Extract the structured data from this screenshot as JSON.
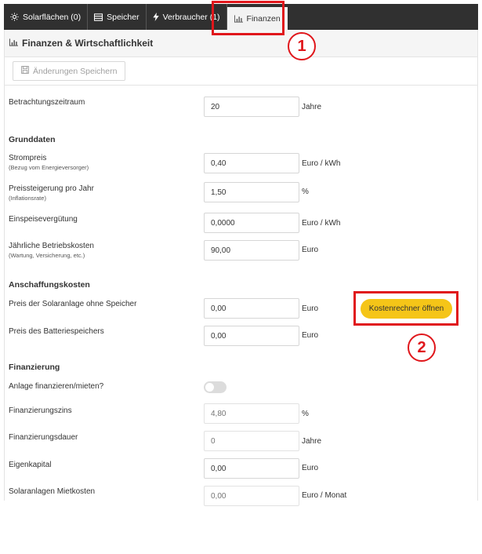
{
  "tabs": [
    {
      "label": "Solarflächen (0)",
      "icon": "sun-icon"
    },
    {
      "label": "Speicher",
      "icon": "battery-icon"
    },
    {
      "label": "Verbraucher (1)",
      "icon": "bolt-icon"
    },
    {
      "label": "Finanzen",
      "icon": "bar-chart-icon",
      "active": true
    }
  ],
  "panel": {
    "title": "Finanzen & Wirtschaftlichkeit",
    "save_label": "Änderungen Speichern"
  },
  "fields": {
    "zeitraum": {
      "label": "Betrachtungszeitraum",
      "value": "20",
      "unit": "Jahre"
    },
    "strompreis": {
      "label": "Strompreis",
      "sub": "(Bezug vom Energieversorger)",
      "value": "0,40",
      "unit": "Euro / kWh"
    },
    "preissteigerung": {
      "label": "Preissteigerung pro Jahr",
      "sub": "(Inflationsrate)",
      "value": "1,50",
      "unit": "%"
    },
    "einspeise": {
      "label": "Einspeisevergütung",
      "value": "0,0000",
      "unit": "Euro / kWh"
    },
    "betriebskosten": {
      "label": "Jährliche Betriebskosten",
      "sub": "(Wartung, Versicherung, etc.)",
      "value": "90,00",
      "unit": "Euro"
    },
    "preis_solar": {
      "label": "Preis der Solaranlage ohne Speicher",
      "value": "0,00",
      "unit": "Euro"
    },
    "preis_batterie": {
      "label": "Preis des Batteriespeichers",
      "value": "0,00",
      "unit": "Euro"
    },
    "finanzieren": {
      "label": "Anlage finanzieren/mieten?",
      "enabled": false
    },
    "zins": {
      "label": "Finanzierungszins",
      "placeholder": "4,80",
      "unit": "%"
    },
    "dauer": {
      "label": "Finanzierungsdauer",
      "placeholder": "0",
      "unit": "Jahre"
    },
    "eigenkapital": {
      "label": "Eigenkapital",
      "value": "0,00",
      "unit": "Euro"
    },
    "mietkosten": {
      "label": "Solaranlagen Mietkosten",
      "placeholder": "0,00",
      "unit": "Euro / Monat"
    }
  },
  "sections": {
    "grunddaten": "Grunddaten",
    "anschaffung": "Anschaffungskosten",
    "finanzierung": "Finanzierung"
  },
  "calc_button_label": "Kostenrechner öffnen",
  "annotations": {
    "one": "1",
    "two": "2"
  },
  "colors": {
    "accent": "#f5c518",
    "annotation": "#e0161b",
    "tabbar": "#303030"
  }
}
